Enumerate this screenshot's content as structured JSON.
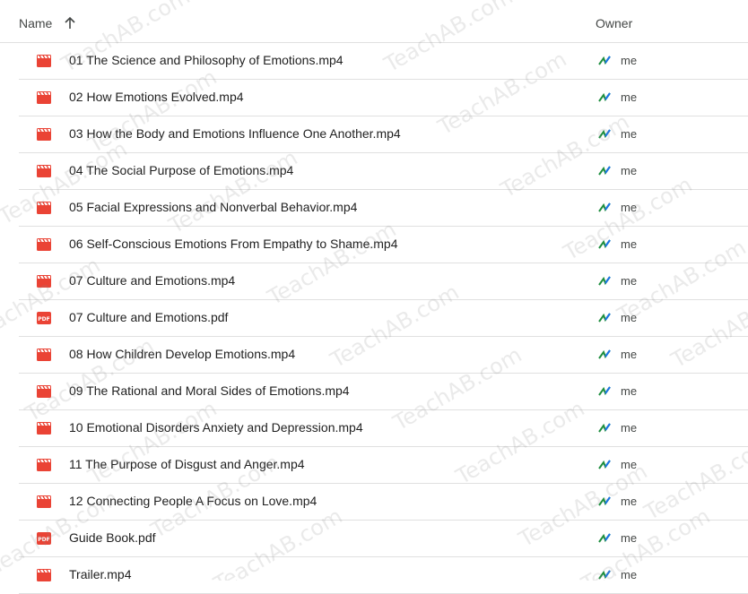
{
  "header": {
    "name_label": "Name",
    "owner_label": "Owner",
    "sort_icon": "arrow-up-icon"
  },
  "files": [
    {
      "name": "01 The Science and Philosophy of Emotions.mp4",
      "type": "video",
      "owner": "me"
    },
    {
      "name": "02 How Emotions Evolved.mp4",
      "type": "video",
      "owner": "me"
    },
    {
      "name": "03 How the Body and Emotions Influence One Another.mp4",
      "type": "video",
      "owner": "me"
    },
    {
      "name": "04 The Social Purpose of Emotions.mp4",
      "type": "video",
      "owner": "me"
    },
    {
      "name": "05 Facial Expressions and Nonverbal Behavior.mp4",
      "type": "video",
      "owner": "me"
    },
    {
      "name": "06 Self-Conscious Emotions From Empathy to Shame.mp4",
      "type": "video",
      "owner": "me"
    },
    {
      "name": "07 Culture and Emotions.mp4",
      "type": "video",
      "owner": "me"
    },
    {
      "name": "07 Culture and Emotions.pdf",
      "type": "pdf",
      "owner": "me"
    },
    {
      "name": "08 How Children Develop Emotions.mp4",
      "type": "video",
      "owner": "me"
    },
    {
      "name": "09 The Rational and Moral Sides of Emotions.mp4",
      "type": "video",
      "owner": "me"
    },
    {
      "name": "10 Emotional Disorders Anxiety and Depression.mp4",
      "type": "video",
      "owner": "me"
    },
    {
      "name": "11 The Purpose of Disgust and Anger.mp4",
      "type": "video",
      "owner": "me"
    },
    {
      "name": "12 Connecting People A Focus on Love.mp4",
      "type": "video",
      "owner": "me"
    },
    {
      "name": "Guide Book.pdf",
      "type": "pdf",
      "owner": "me"
    },
    {
      "name": "Trailer.mp4",
      "type": "video",
      "owner": "me"
    }
  ],
  "watermark": "TeachAB.com",
  "colors": {
    "video_icon": "#ea4335",
    "pdf_icon": "#ea4335",
    "owner_icon_green": "#1e8e3e",
    "owner_icon_blue": "#1a73e8"
  }
}
